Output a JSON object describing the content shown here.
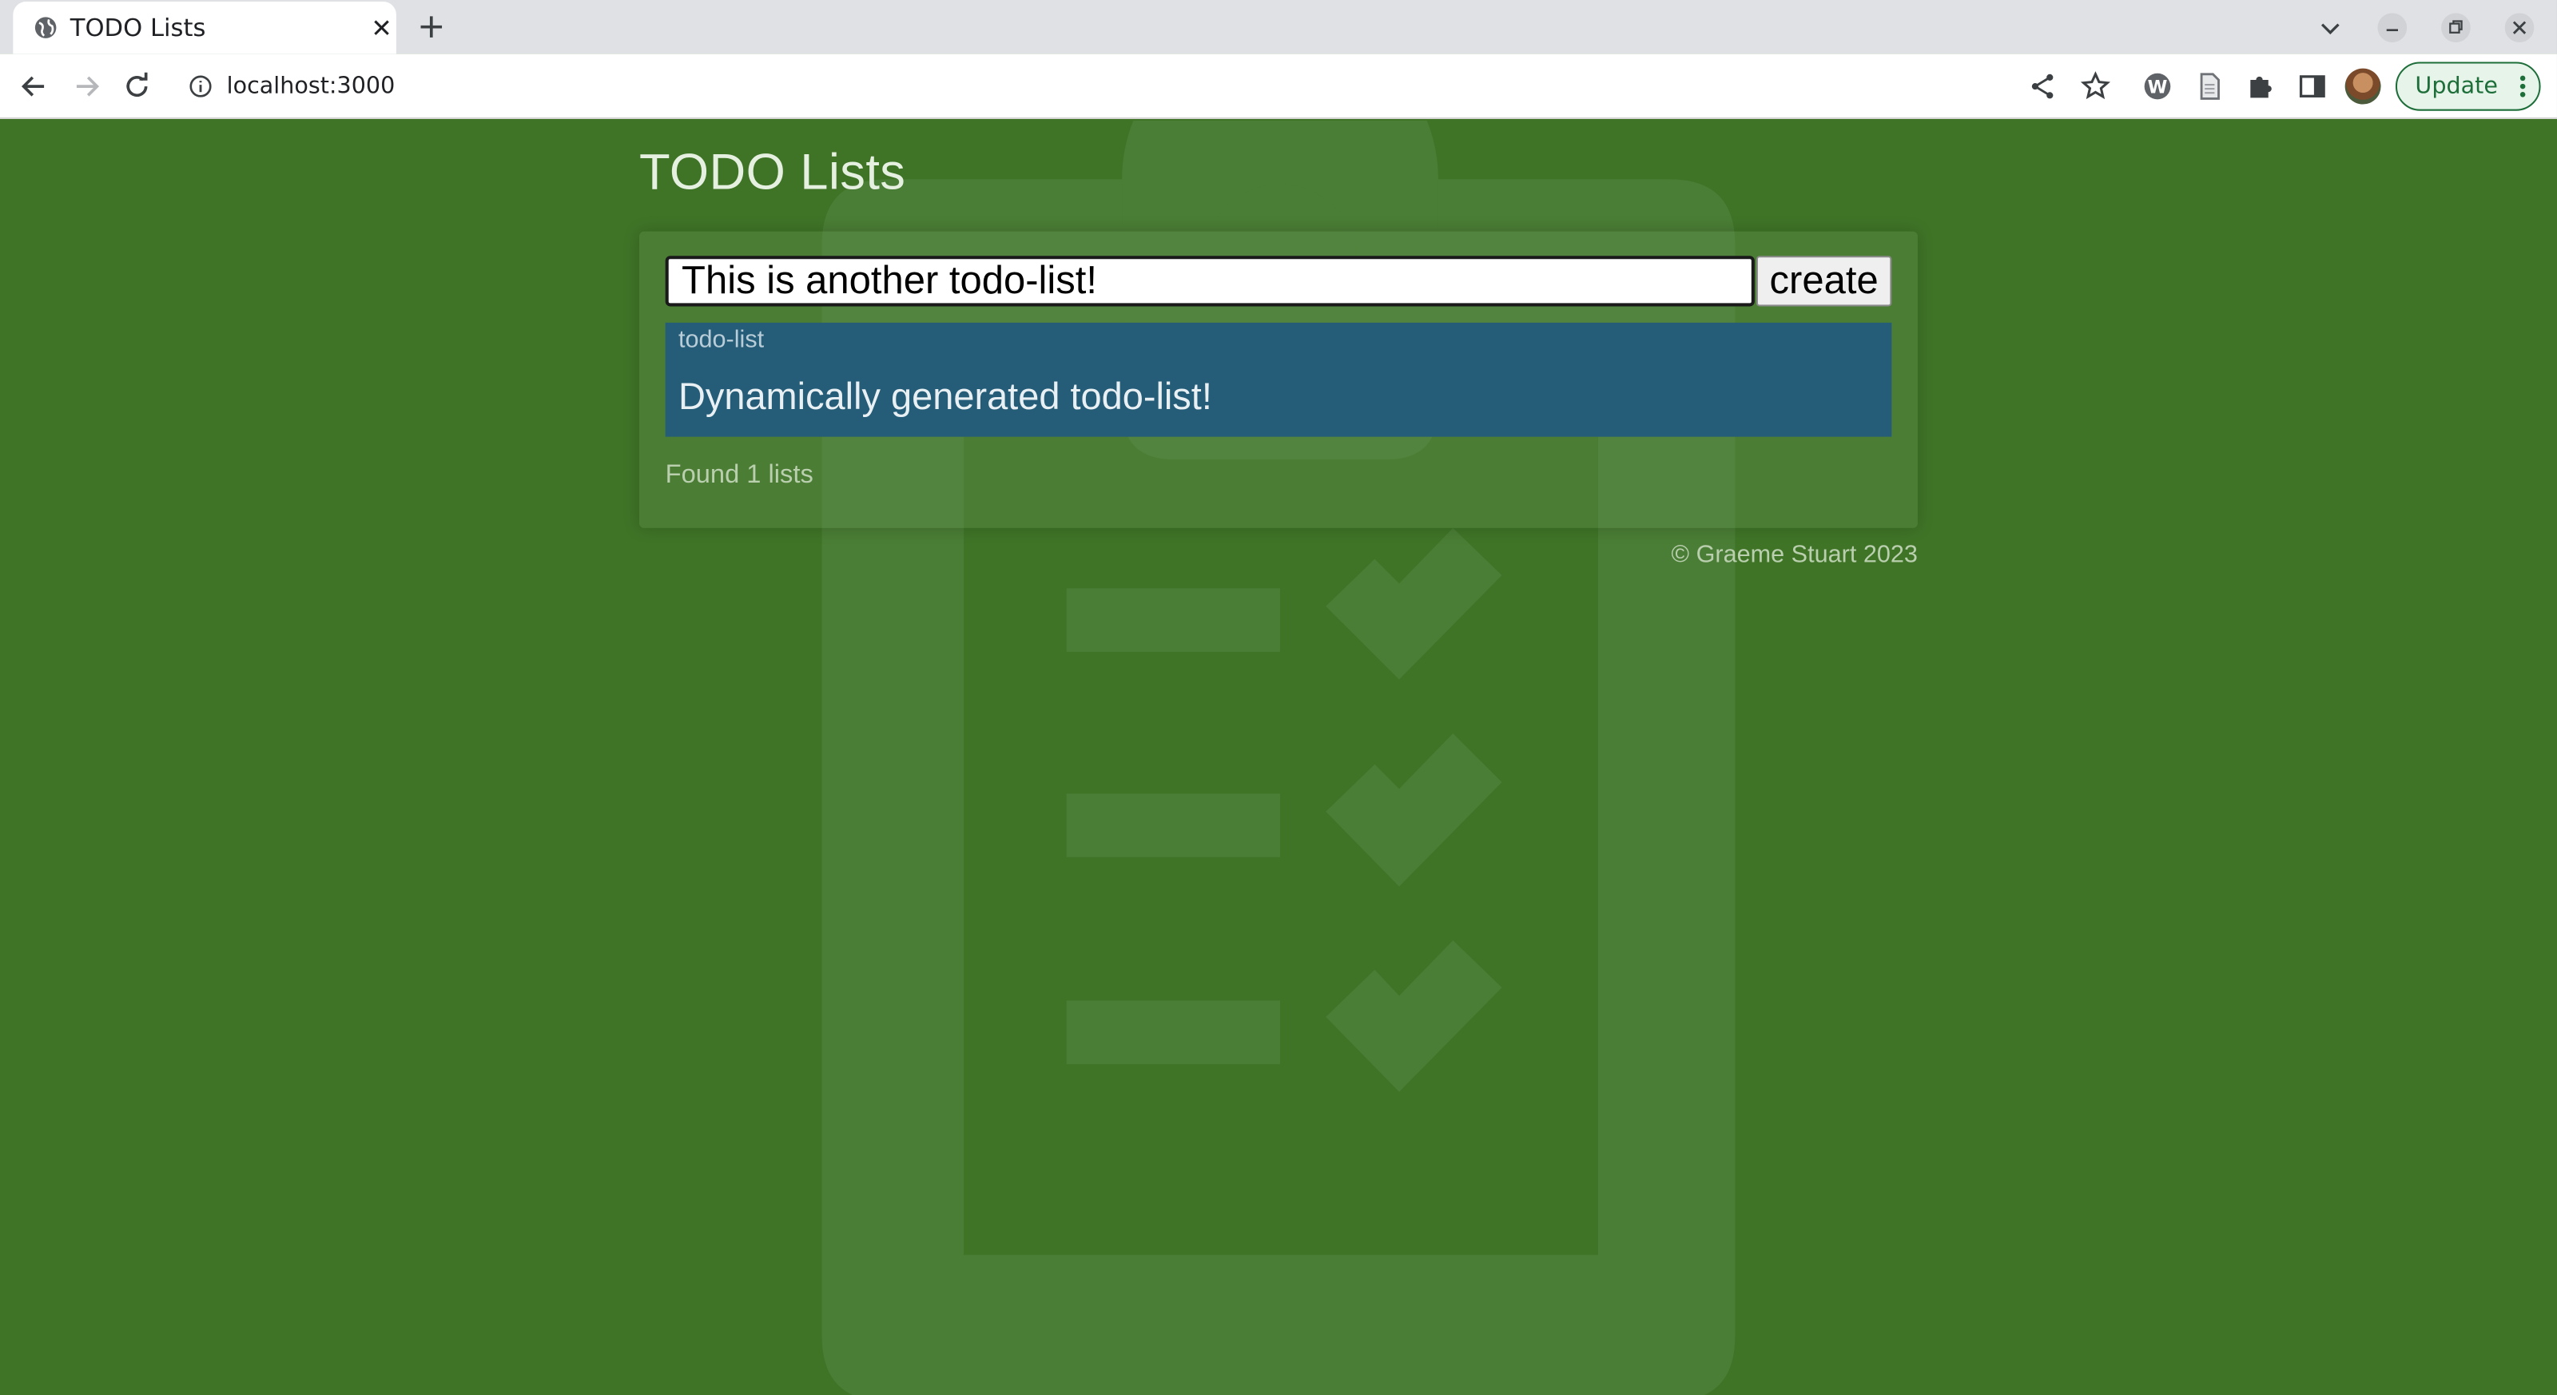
{
  "browser": {
    "tab_title": "TODO Lists",
    "url": "localhost:3000",
    "update_label": "Update"
  },
  "page": {
    "title": "TODO Lists",
    "input_value": "This is another todo-list!",
    "create_label": "create",
    "lists": [
      {
        "kind": "todo-list",
        "name": "Dynamically generated todo-list!"
      }
    ],
    "found_text": "Found 1 lists",
    "footer": "© Graeme Stuart 2023"
  },
  "colors": {
    "page_bg": "#3f7427",
    "list_card_bg": "#255c78"
  },
  "icons": [
    "globe-icon",
    "close-icon",
    "plus-icon",
    "chevron-down-icon",
    "minimize-icon",
    "restore-icon",
    "window-close-icon",
    "back-icon",
    "forward-icon",
    "reload-icon",
    "info-icon",
    "share-icon",
    "star-icon",
    "wordpress-icon",
    "page-icon",
    "puzzle-icon",
    "sidepanel-icon",
    "avatar",
    "more-vert-icon",
    "clipboard-check-icon"
  ]
}
